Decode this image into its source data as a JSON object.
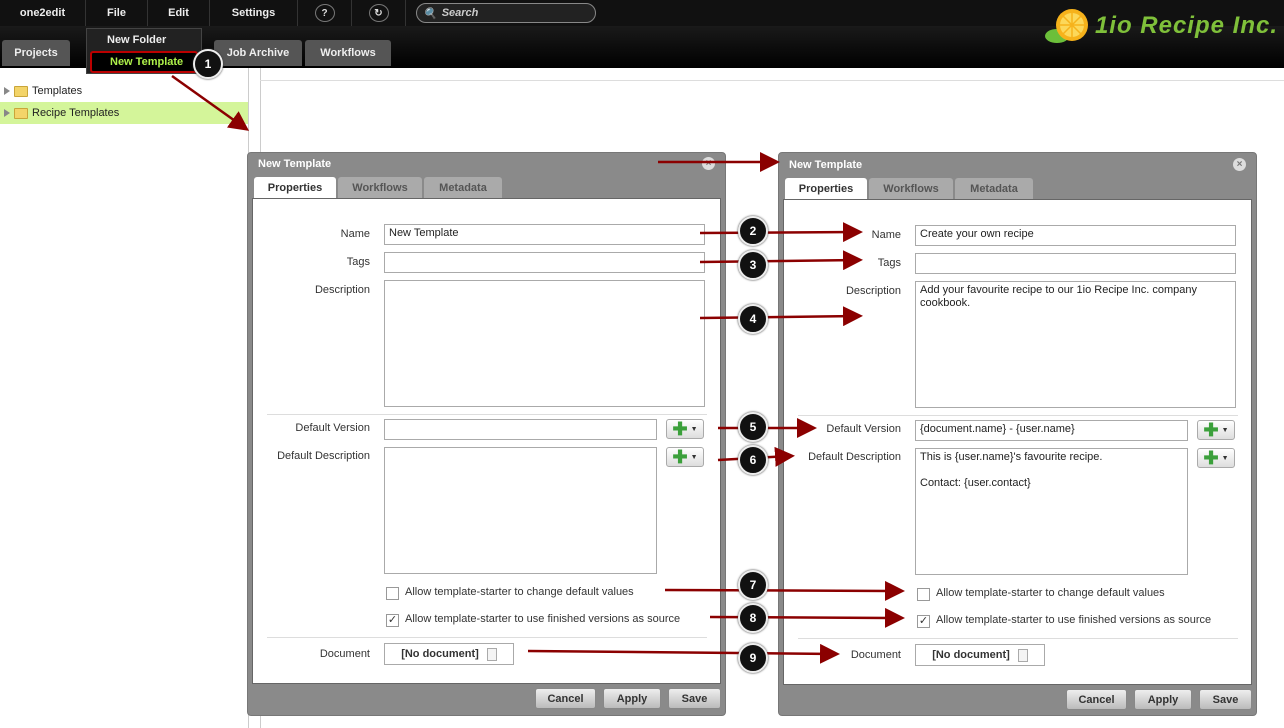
{
  "menubar": {
    "app": "one2edit",
    "file": "File",
    "edit": "Edit",
    "settings": "Settings",
    "help_icon": "question-icon",
    "refresh_icon": "refresh-icon",
    "search_placeholder": "Search"
  },
  "logo": {
    "text": "1io Recipe Inc.",
    "brand_color": "#7fc03a"
  },
  "tabs": [
    "Projects",
    "Job Archive",
    "Workflows"
  ],
  "file_menu": {
    "new_folder": "New Folder",
    "new_template": "New Template"
  },
  "tree": [
    {
      "label": "Templates"
    },
    {
      "label": "Recipe Templates"
    }
  ],
  "dialog_left": {
    "title": "New Template",
    "tabs": [
      "Properties",
      "Workflows",
      "Metadata"
    ],
    "labels": {
      "name": "Name",
      "tags": "Tags",
      "description": "Description",
      "default_version": "Default Version",
      "default_description": "Default Description",
      "document": "Document"
    },
    "values": {
      "name": "New Template",
      "tags": "",
      "description": "",
      "default_version": "",
      "default_description": ""
    },
    "check1": {
      "label": "Allow template-starter to change default values",
      "checked": false
    },
    "check2": {
      "label": "Allow template-starter to use finished versions as source",
      "checked": true
    },
    "document": "[No document]",
    "buttons": {
      "cancel": "Cancel",
      "apply": "Apply",
      "save": "Save"
    }
  },
  "dialog_right": {
    "title": "New Template",
    "tabs": [
      "Properties",
      "Workflows",
      "Metadata"
    ],
    "labels": {
      "name": "Name",
      "tags": "Tags",
      "description": "Description",
      "default_version": "Default Version",
      "default_description": "Default Description",
      "document": "Document"
    },
    "values": {
      "name": "Create your own recipe",
      "tags": "",
      "description": "Add your favourite recipe to our 1io Recipe Inc. company cookbook.",
      "default_version": "{document.name} - {user.name}",
      "default_description_1": "This is {user.name}'s favourite recipe.",
      "default_description_2": "Contact: {user.contact}"
    },
    "check1": {
      "label": "Allow template-starter to change default values",
      "checked": false
    },
    "check2": {
      "label": "Allow template-starter to use finished versions as source",
      "checked": true
    },
    "document": "[No document]",
    "buttons": {
      "cancel": "Cancel",
      "apply": "Apply",
      "save": "Save"
    }
  },
  "badges": [
    "1",
    "2",
    "3",
    "4",
    "5",
    "6",
    "7",
    "8",
    "9"
  ],
  "colors": {
    "arrow": "#8b0000",
    "highlight": "#d4f59a"
  }
}
